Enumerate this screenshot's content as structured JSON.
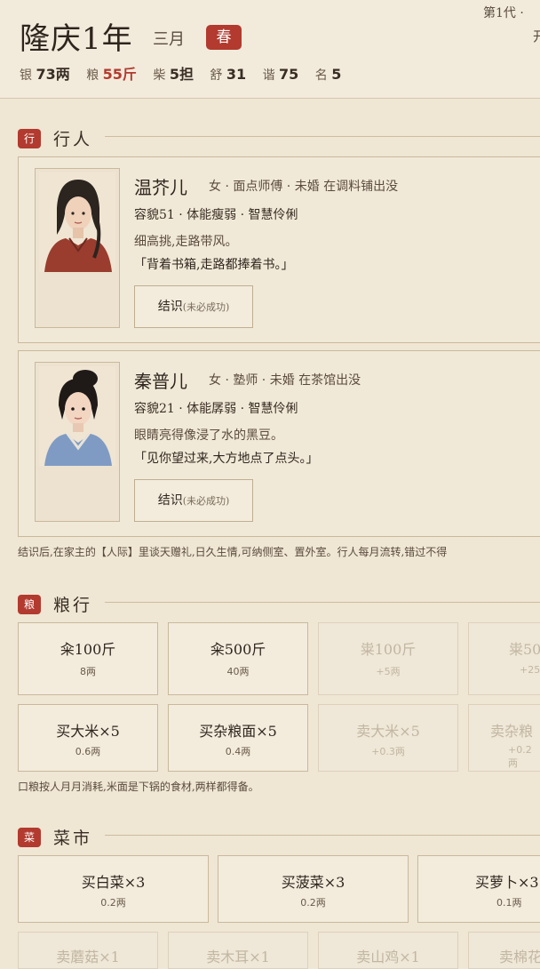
{
  "header": {
    "year": "隆庆1年",
    "month": "三月",
    "season": "春",
    "generation": "第1代 ·",
    "right_cut": "开",
    "stats": [
      {
        "label": "银",
        "value": "73两",
        "red": false
      },
      {
        "label": "粮",
        "value": "55斤",
        "red": true
      },
      {
        "label": "柴",
        "value": "5担",
        "red": false
      },
      {
        "label": "舒",
        "value": "31",
        "red": false
      },
      {
        "label": "谐",
        "value": "75",
        "red": false
      },
      {
        "label": "名",
        "value": "5",
        "red": false
      }
    ]
  },
  "sections": {
    "walkers": {
      "icon": "行",
      "title": "行人"
    },
    "grain": {
      "icon": "粮",
      "title": "粮行"
    },
    "veg": {
      "icon": "菜",
      "title": "菜市"
    }
  },
  "people": [
    {
      "name": "温芥儿",
      "meta": "女 · 面点师傅 · 未婚   在调料铺出没",
      "stats": "容貌51 · 体能瘦弱 · 智慧伶俐",
      "desc": "细高挑,走路带风。",
      "quote": "「背着书箱,走路都捧着书。」",
      "btn": "结识",
      "btn_note": "(未必成功)",
      "outfit": "#9a3d2e"
    },
    {
      "name": "秦普儿",
      "meta": "女 · 塾师 · 未婚   在茶馆出没",
      "stats": "容貌21 · 体能孱弱 · 智慧伶俐",
      "desc": "眼睛亮得像浸了水的黑豆。",
      "quote": "「见你望过来,大方地点了点头。」",
      "btn": "结识",
      "btn_note": "(未必成功)",
      "outfit": "#7f9bc4"
    }
  ],
  "walkers_note": "结识后,在家主的【人际】里谈天赠礼,日久生情,可纳侧室、置外室。行人每月流转,错过不得",
  "grain_row1": [
    {
      "label": "籴100斤",
      "sub": "8两",
      "disabled": false
    },
    {
      "label": "籴500斤",
      "sub": "40两",
      "disabled": false
    },
    {
      "label": "粜100斤",
      "sub": "+5两",
      "disabled": true
    },
    {
      "label": "粜50",
      "sub": "+25",
      "disabled": true
    }
  ],
  "grain_row2": [
    {
      "label": "买大米×5",
      "sub": "0.6两",
      "disabled": false
    },
    {
      "label": "买杂粮面×5",
      "sub": "0.4两",
      "disabled": false
    },
    {
      "label": "卖大米×5",
      "sub": "+0.3两",
      "disabled": true
    },
    {
      "label": "卖杂粮",
      "sub": "+0.2两",
      "disabled": true
    }
  ],
  "grain_note": "口粮按人月月消耗,米面是下锅的食材,两样都得备。",
  "veg_row1": [
    {
      "label": "买白菜×3",
      "sub": "0.2两",
      "disabled": false
    },
    {
      "label": "买菠菜×3",
      "sub": "0.2两",
      "disabled": false
    },
    {
      "label": "买萝卜×3",
      "sub": "0.1两",
      "disabled": false
    }
  ],
  "veg_row2": [
    {
      "label": "卖蘑菇×1",
      "sub": "",
      "disabled": true
    },
    {
      "label": "卖木耳×1",
      "sub": "",
      "disabled": true
    },
    {
      "label": "卖山鸡×1",
      "sub": "",
      "disabled": true
    },
    {
      "label": "卖棉花",
      "sub": "",
      "disabled": true
    }
  ]
}
